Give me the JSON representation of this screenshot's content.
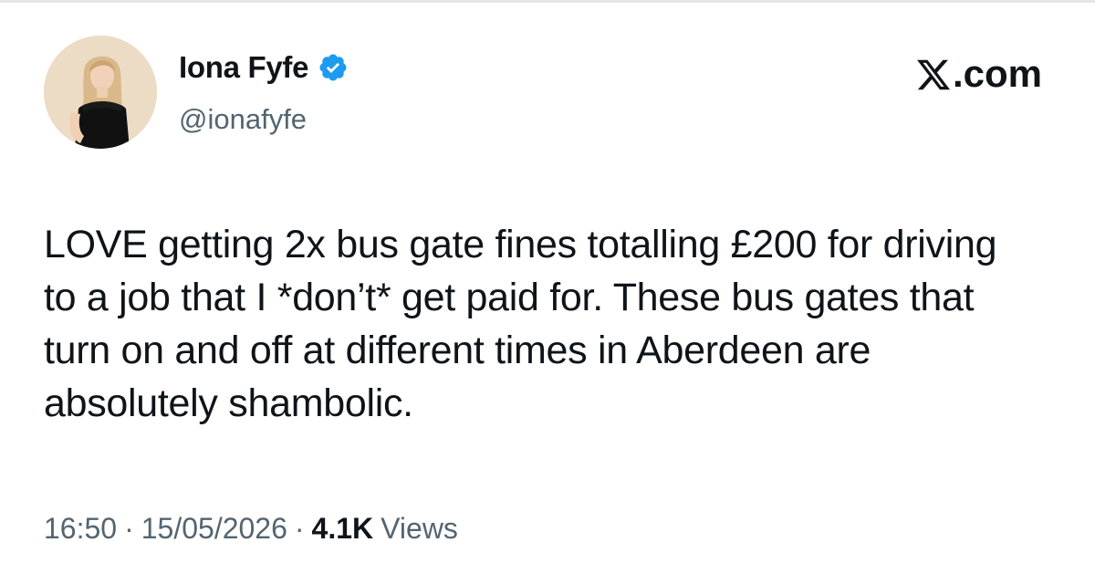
{
  "author": {
    "display_name": "Iona Fyfe",
    "handle": "@ionafyfe",
    "verified": true,
    "badge_color": "#1d9bf0"
  },
  "brand": {
    "logo_icon": "x-logo-icon",
    "label": ".com"
  },
  "tweet": {
    "text": "LOVE getting 2x bus gate fines totalling £200 for driving to a job that I *don’t* get paid for. These bus gates that turn on and off at different times in Aberdeen are absolutely shambolic."
  },
  "meta": {
    "time": "16:50",
    "separator": "·",
    "date": "15/05/2026",
    "views_count": "4.1K",
    "views_label": "Views"
  }
}
